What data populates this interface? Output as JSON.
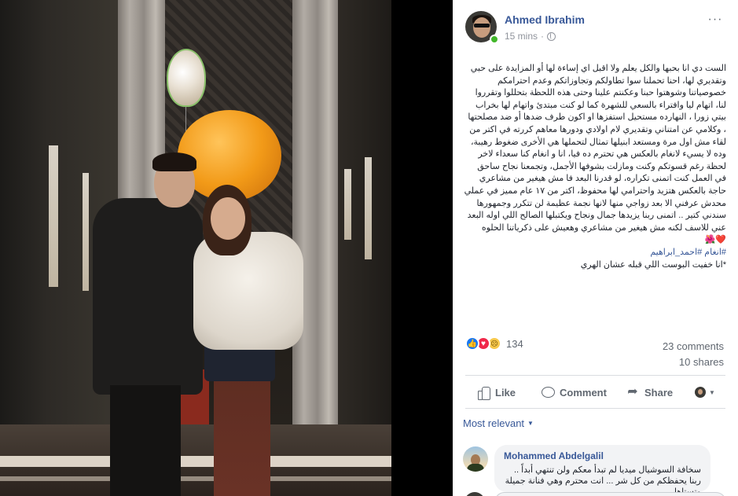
{
  "post": {
    "author": "Ahmed Ibrahim",
    "time": "15 mins",
    "visibility_icon": "globe-icon",
    "menu_label": "···",
    "text_lines": [
      "الست دي انا بحبها والكل يعلم ولا اقبل اي إساءة لها أو المزايدة على حبي وتقديري لها، احنا تحملنا سوا تطاولكم وتجاوزاتكم وعدم احترامكم خصوصياتنا وشوهتوا حبنا وعكنتم علينا وحتى هذه اللحظة بتحللوا وتقرروا لنا، اتهام ليا وافتراء بالسعي للشهرة كما لو كنت مبتدئ واتهام لها بخراب بيتي زورا ، النهارده مستحيل استفزها او اكون طرف ضدها أو ضد مصلحتها ، وكلامي عن امتناني وتقديري لام اولادي ودورها معاهم كررته في اكتر من لقاء مش اول مرة ومستعد ابنيلها تمثال لتحملها هي الأخرى ضغوط رهيبة، وده لا يسيء لانغام بالعكس هي تحترم ده فيا، انا و انغام كنا سعداء لاخر لحظة رغم قسوتكم وكنت ومازلت بشوفها الأجمل، وتجمعنا نجاح ساحق في العمل كنت اتمنى تكراره، لو قدرنا البعد فا مش هيغير من مشاعري حاجة بالعكس هتزيد واحترامي لها محفوظ، اكتر من ١٧ عام مميز في عملي محدش عرفني الا بعد زواجي منها لانها نجمة عظيمة لن تتكرر وجمهورها سندني كتير .. اتمنى ربنا يزيدها جمال ونجاح ويكتبلها الصالح اللي اوله البعد عني للاسف لكنه مش هيغير من مشاعري وهعيش على ذكرياتنا الحلوه"
    ],
    "hearts": "❤️🌺",
    "hashtags": "#انغام #احمد_ابراهيم",
    "footnote": "*انا خفيت البوست اللي قبله عشان الهري"
  },
  "reactions": {
    "icons": [
      "like-icon",
      "love-icon",
      "sad-icon"
    ],
    "count": "134",
    "comments": "23 comments",
    "shares": "10 shares"
  },
  "actions": {
    "like": "Like",
    "comment": "Comment",
    "share": "Share"
  },
  "sort": {
    "label": "Most relevant"
  },
  "comment": {
    "author": "Mohammed Abdelgalil",
    "text": "سخافة السوشيال ميديا لم تبدأ معكم ولن تنتهي أبداً .. ربنا يحفظكم من كل شر ... انت محترم وهي فنانة جميلة وتستاهل"
  },
  "colors": {
    "link": "#385898",
    "online": "#42b72a",
    "like": "#1877f2",
    "love": "#f0284a",
    "sad": "#f7c84a"
  }
}
